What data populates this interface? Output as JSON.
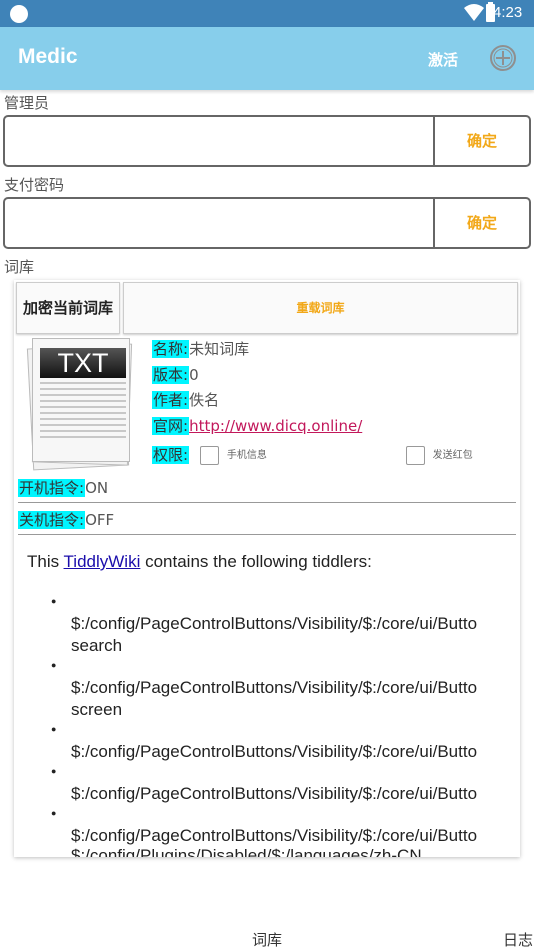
{
  "status_bar": {
    "time": "4:23"
  },
  "app_bar": {
    "title": "Medic",
    "activate_label": "激活"
  },
  "admin": {
    "label": "管理员",
    "input_value": "",
    "confirm_label": "确定"
  },
  "pay_password": {
    "label": "支付密码",
    "input_value": "",
    "confirm_label": "确定"
  },
  "lexicon": {
    "label": "词库",
    "encrypt_button": "加密当前词库",
    "reload_button": "重载词库",
    "icon_text": "TXT",
    "info": {
      "name_label": "名称:",
      "name_value": "未知词库",
      "version_label": "版本:",
      "version_value": "0",
      "author_label": "作者:",
      "author_value": "佚名",
      "website_label": "官网:",
      "website_value": "http://www.dicq.online/",
      "permission_label": "权限:",
      "permissions": [
        "手机信息",
        "发送红包"
      ]
    },
    "boot_command": {
      "label": "开机指令:",
      "value": "ON"
    },
    "shutdown_command": {
      "label": "关机指令:",
      "value": "OFF"
    },
    "wiki": {
      "intro_prefix": "This ",
      "intro_link": "TiddlyWiki",
      "intro_suffix": " contains the following tiddlers:",
      "tiddlers": [
        "$:/config/PageControlButtons/Visibility/$:/core/ui/Butto",
        "search",
        "$:/config/PageControlButtons/Visibility/$:/core/ui/Butto",
        "screen",
        "$:/config/PageControlButtons/Visibility/$:/core/ui/Butto",
        "$:/config/PageControlButtons/Visibility/$:/core/ui/Butto",
        "$:/config/PageControlButtons/Visibility/$:/core/ui/Butto",
        "$:/config/Plugins/Disabled/$:/languages/zh-CN"
      ]
    }
  },
  "bottom_nav": {
    "tab_lexicon": "词库",
    "tab_log": "日志"
  },
  "colors": {
    "status_bar": "#3f83b8",
    "app_bar": "#87ceeb",
    "accent": "#f2a818",
    "highlight": "#00f5ff",
    "link": "#c2185b"
  }
}
